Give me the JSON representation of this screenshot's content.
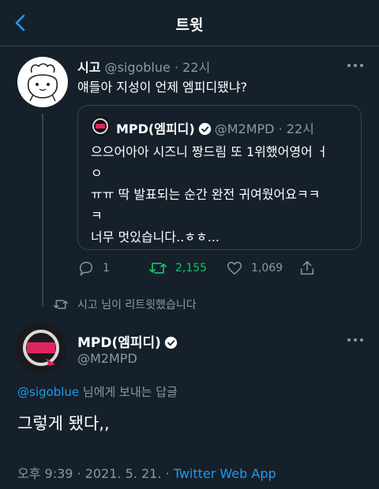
{
  "header": {
    "title": "트윗"
  },
  "tweet": {
    "name": "시고",
    "handle": "@sigoblue",
    "time": "22시",
    "text": "얘들아 지성이 언제 엠피디됐냐?",
    "quote": {
      "name": "MPD(엠피디)",
      "handle": "@M2MPD",
      "time": "22시",
      "text_line1": "으으어아아 시즈니 짱드림 또 1위했어영어 ㅓ",
      "text_line2": "ㅇ",
      "text_line3": "ㅠㅠ 딱 발표되는 순간 완전 귀여웠어요ㅋㅋ",
      "text_line4": "ㅋ",
      "text_line5": "너무 멋있습니다..ㅎㅎ..."
    },
    "actions": {
      "replies": "1",
      "retweets": "2,155",
      "likes": "1,069"
    }
  },
  "retweet_notice": "시고 님이 리트윗했습니다",
  "main_tweet": {
    "name": "MPD(엠피디)",
    "handle": "@M2MPD",
    "reply_to_handle": "@sigoblue",
    "reply_to_suffix": "님에게 보내는 답글",
    "text": "그렇게 됐다,,",
    "time": "오후 9:39",
    "date": "2021. 5. 21.",
    "source": "Twitter Web App",
    "separator": " · "
  },
  "colors": {
    "background": "#15202b",
    "accent": "#1d9bf0",
    "muted": "#8899a6",
    "retweet_green": "#17bf63",
    "divider": "#38444d"
  },
  "icons": [
    "back-arrow-icon",
    "more-icon",
    "verified-badge-icon",
    "reply-icon",
    "retweet-icon",
    "like-icon",
    "share-icon"
  ]
}
